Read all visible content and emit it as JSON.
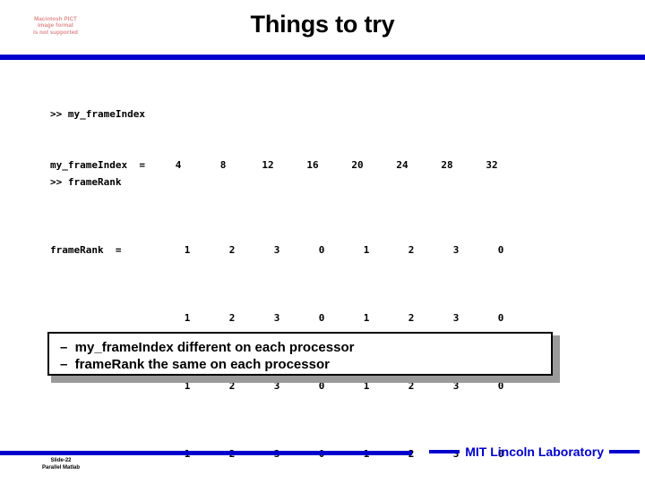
{
  "slide": {
    "title": "Things to try",
    "accent_color": "#0000CC",
    "placeholder": {
      "line1": "Macintosh PICT",
      "line2": "image format",
      "line3": "is not supported",
      "color": "#E08D8D"
    }
  },
  "console": {
    "block1": {
      "prompt_line": ">> my_frameIndex",
      "prompt": ">>",
      "command": "my_frameIndex",
      "result_label": "my_frameIndex  =",
      "values": [
        "4",
        "8",
        "12",
        "16",
        "20",
        "24",
        "28",
        "32"
      ]
    },
    "block2": {
      "prompt_line": ">> frameRank",
      "prompt": ">>",
      "command": "frameRank",
      "result_label": "frameRank  =",
      "rows": [
        [
          "1",
          "2",
          "3",
          "0",
          "1",
          "2",
          "3",
          "0"
        ],
        [
          "1",
          "2",
          "3",
          "0",
          "1",
          "2",
          "3",
          "0"
        ],
        [
          "1",
          "2",
          "3",
          "0",
          "1",
          "2",
          "3",
          "0"
        ],
        [
          "1",
          "2",
          "3",
          "0",
          "1",
          "2",
          "3",
          "0"
        ]
      ]
    }
  },
  "callout": {
    "bullet1": "–  my_frameIndex different on each processor",
    "bullet2": "–  frameRank the same on each processor"
  },
  "footer": {
    "slide_number": "Slide-22",
    "deck_name": "Parallel Matlab",
    "brand": "MIT Lincoln Laboratory"
  }
}
